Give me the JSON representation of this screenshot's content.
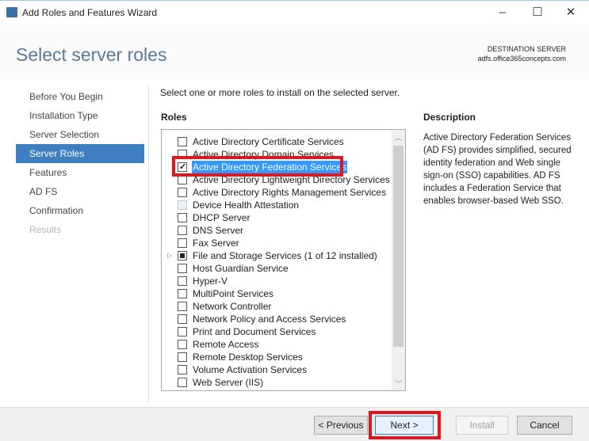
{
  "window": {
    "title": "Add Roles and Features Wizard",
    "minimize": "–",
    "maximize": "☐",
    "close": "✕"
  },
  "header": {
    "title": "Select server roles",
    "dest_label": "DESTINATION SERVER",
    "dest_server": "adfs.office365concepts.com"
  },
  "nav": [
    {
      "label": "Before You Begin",
      "state": "normal"
    },
    {
      "label": "Installation Type",
      "state": "normal"
    },
    {
      "label": "Server Selection",
      "state": "normal"
    },
    {
      "label": "Server Roles",
      "state": "selected"
    },
    {
      "label": "Features",
      "state": "normal"
    },
    {
      "label": "AD FS",
      "state": "normal"
    },
    {
      "label": "Confirmation",
      "state": "normal"
    },
    {
      "label": "Results",
      "state": "disabled"
    }
  ],
  "main": {
    "instruction": "Select one or more roles to install on the selected server.",
    "roles_heading": "Roles",
    "description_heading": "Description",
    "description": "Active Directory Federation Services (AD FS) provides simplified, secured identity federation and Web single sign-on (SSO) capabilities. AD FS includes a Federation Service that enables browser-based Web SSO."
  },
  "roles": [
    {
      "label": "Active Directory Certificate Services",
      "state": "unchecked"
    },
    {
      "label": "Active Directory Domain Services",
      "state": "unchecked"
    },
    {
      "label": "Active Directory Federation Services",
      "state": "checked",
      "selected": true
    },
    {
      "label": "Active Directory Lightweight Directory Services",
      "state": "unchecked"
    },
    {
      "label": "Active Directory Rights Management Services",
      "state": "unchecked"
    },
    {
      "label": "Device Health Attestation",
      "state": "disabled"
    },
    {
      "label": "DHCP Server",
      "state": "unchecked"
    },
    {
      "label": "DNS Server",
      "state": "unchecked"
    },
    {
      "label": "Fax Server",
      "state": "unchecked"
    },
    {
      "label": "File and Storage Services (1 of 12 installed)",
      "state": "partial",
      "expandable": true
    },
    {
      "label": "Host Guardian Service",
      "state": "unchecked"
    },
    {
      "label": "Hyper-V",
      "state": "unchecked"
    },
    {
      "label": "MultiPoint Services",
      "state": "unchecked"
    },
    {
      "label": "Network Controller",
      "state": "unchecked"
    },
    {
      "label": "Network Policy and Access Services",
      "state": "unchecked"
    },
    {
      "label": "Print and Document Services",
      "state": "unchecked"
    },
    {
      "label": "Remote Access",
      "state": "unchecked"
    },
    {
      "label": "Remote Desktop Services",
      "state": "unchecked"
    },
    {
      "label": "Volume Activation Services",
      "state": "unchecked"
    },
    {
      "label": "Web Server (IIS)",
      "state": "unchecked"
    }
  ],
  "buttons": {
    "previous": "< Previous",
    "next": "Next >",
    "install": "Install",
    "cancel": "Cancel"
  },
  "colors": {
    "accent": "#3e7fc1",
    "selection": "#3399ff",
    "annotation": "#e3161f"
  }
}
